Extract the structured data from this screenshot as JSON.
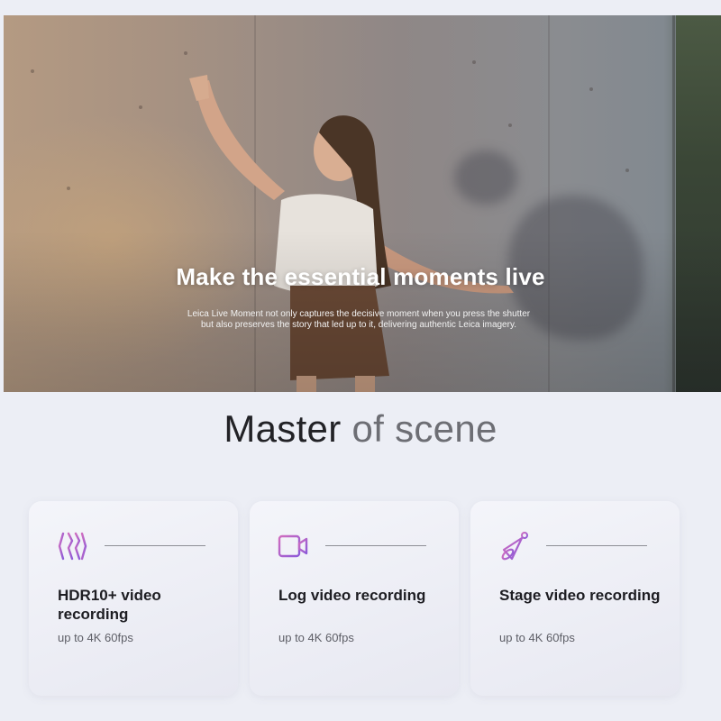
{
  "hero": {
    "title": "Make the essential moments live",
    "description": "Leica Live Moment not only captures the decisive moment when you press the shutter but also preserves the story that led up to it, delivering authentic Leica imagery."
  },
  "section": {
    "title_main": "Master ",
    "title_muted": "of scene"
  },
  "features": [
    {
      "icon": "hdr-waves-icon",
      "title": "HDR10+ video recording",
      "subtitle": "up to 4K 60fps"
    },
    {
      "icon": "video-camera-icon",
      "title": "Log video recording",
      "subtitle": "up to 4K 60fps"
    },
    {
      "icon": "spotlight-icon",
      "title": "Stage video recording",
      "subtitle": "up to 4K 60fps"
    }
  ],
  "colors": {
    "accent": "#b15fc9",
    "heading": "#222226",
    "muted": "#6d6e74"
  }
}
